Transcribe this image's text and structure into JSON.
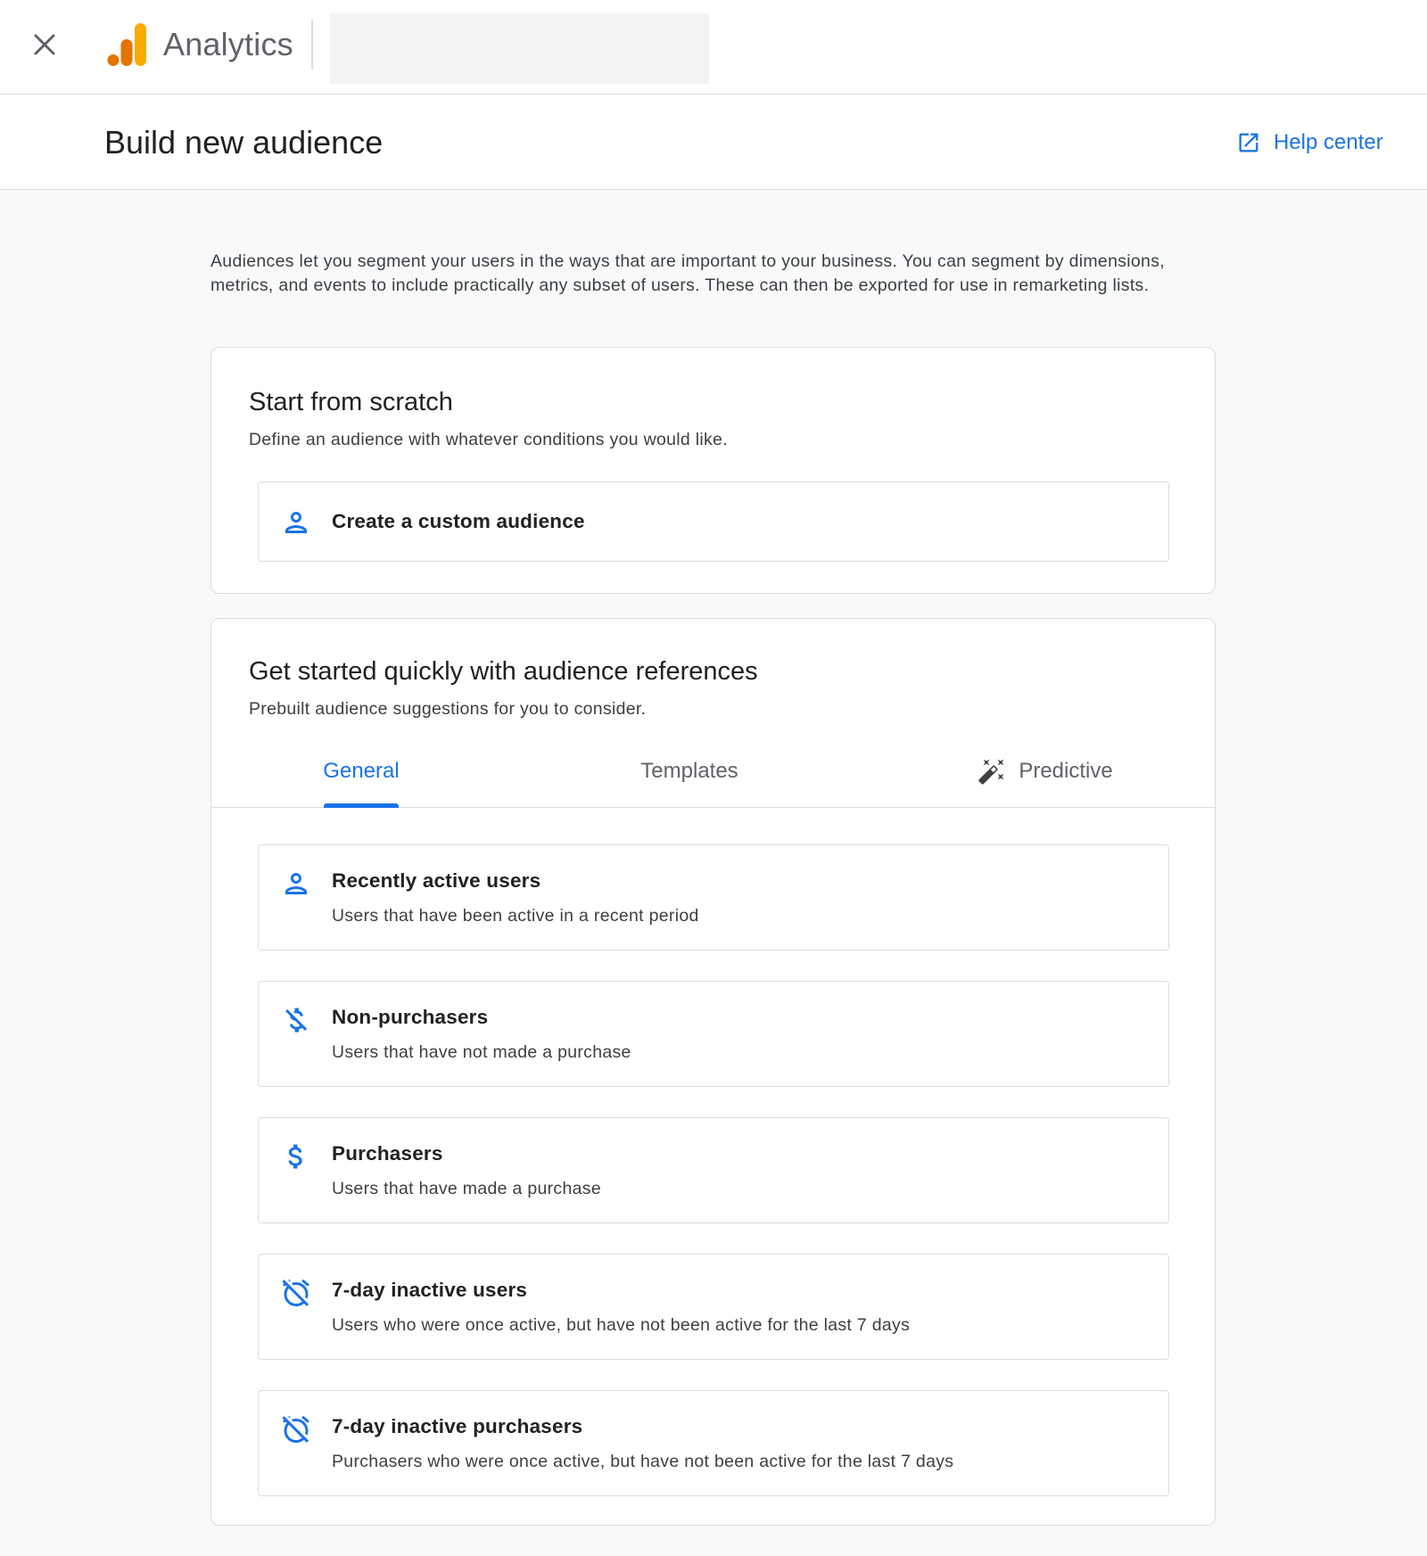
{
  "header": {
    "app_name": "Analytics"
  },
  "titlebar": {
    "title": "Build new audience",
    "help_label": "Help center"
  },
  "intro_text": "Audiences let you segment your users in the ways that are important to your business. You can segment by dimensions, metrics, and events to include practically any subset of users. These can then be exported for use in remarketing lists.",
  "scratch": {
    "title": "Start from scratch",
    "subtitle": "Define an audience with whatever conditions you would like.",
    "custom_option": "Create a custom audience"
  },
  "references": {
    "title": "Get started quickly with audience references",
    "subtitle": "Prebuilt audience suggestions for you to consider.",
    "tabs": [
      {
        "label": "General",
        "active": true
      },
      {
        "label": "Templates",
        "active": false
      },
      {
        "label": "Predictive",
        "active": false
      }
    ],
    "items": [
      {
        "title": "Recently active users",
        "description": "Users that have been active in a recent period",
        "icon": "person-icon"
      },
      {
        "title": "Non-purchasers",
        "description": "Users that have not made a purchase",
        "icon": "money-off-icon"
      },
      {
        "title": "Purchasers",
        "description": "Users that have made a purchase",
        "icon": "dollar-icon"
      },
      {
        "title": "7-day inactive users",
        "description": "Users who were once active, but have not been active for the last 7 days",
        "icon": "alarm-off-icon"
      },
      {
        "title": "7-day inactive purchasers",
        "description": "Purchasers who were once active, but have not been active for the last 7 days",
        "icon": "alarm-off-icon"
      }
    ]
  },
  "colors": {
    "accent": "#1a73e8",
    "logo_orange": "#e37400",
    "logo_yellow": "#f9ab00"
  }
}
